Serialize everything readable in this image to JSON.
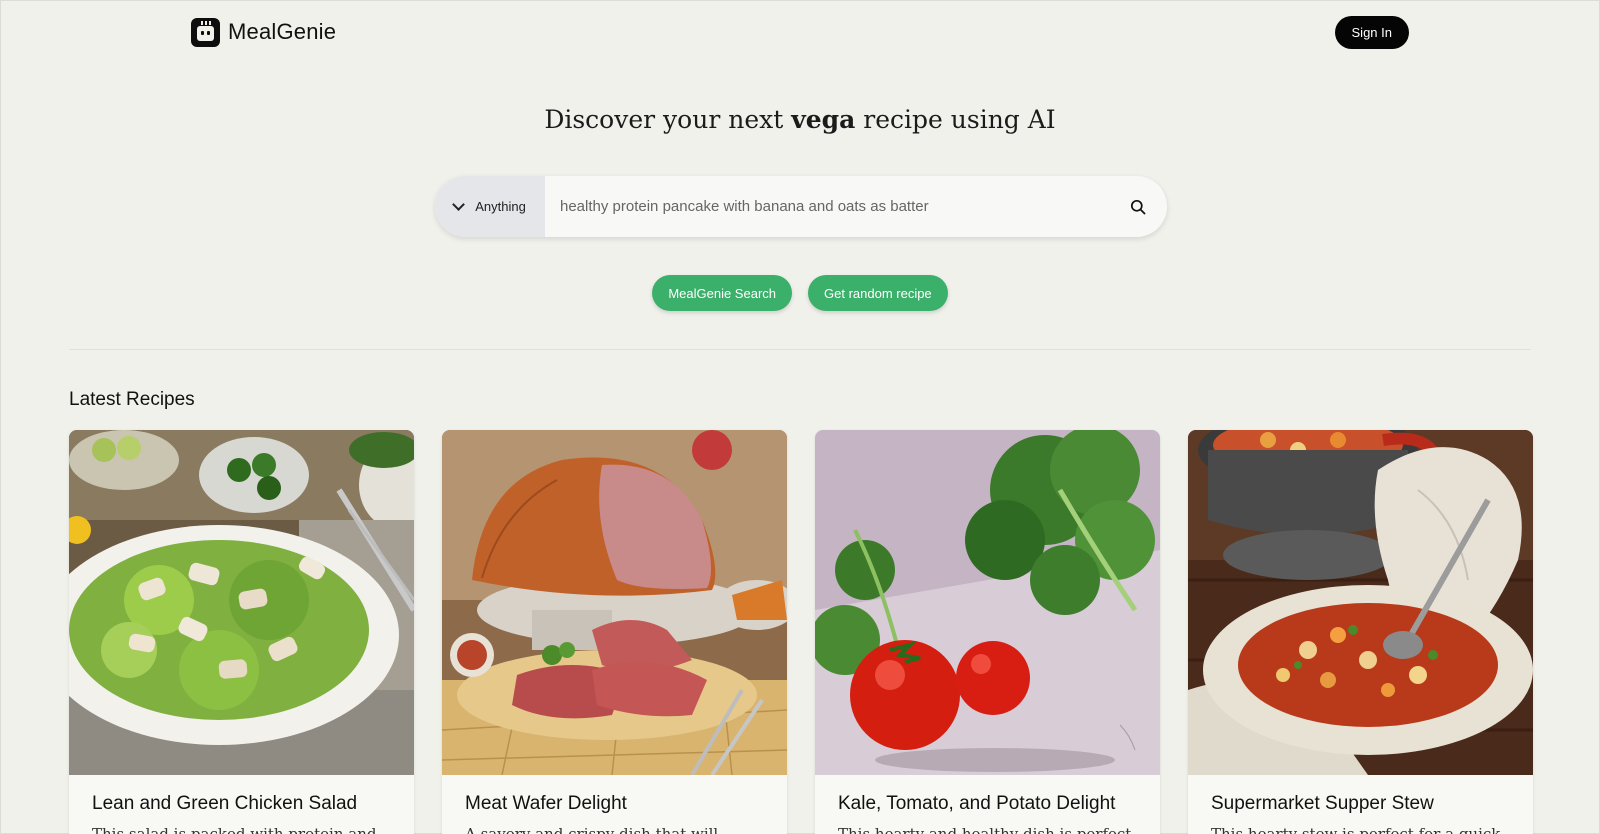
{
  "brand": {
    "name": "MealGenie",
    "logo_icon": "robot-chef-icon"
  },
  "header": {
    "signin_label": "Sign In"
  },
  "hero": {
    "title_prefix": "Discover your next ",
    "title_highlight": "vega",
    "title_suffix": " recipe using AI"
  },
  "search": {
    "category_selected": "Anything",
    "placeholder": "healthy protein pancake with banana and oats as batter",
    "search_icon": "search-icon"
  },
  "actions": {
    "search_label": "MealGenie Search",
    "random_label": "Get random recipe"
  },
  "latest": {
    "heading": "Latest Recipes",
    "recipes": [
      {
        "title": "Lean and Green Chicken Salad",
        "description": "This salad is packed with protein and"
      },
      {
        "title": "Meat Wafer Delight",
        "description": "A savory and crispy dish that will"
      },
      {
        "title": "Kale, Tomato, and Potato Delight",
        "description": "This hearty and healthy dish is perfect"
      },
      {
        "title": "Supermarket Supper Stew",
        "description": "This hearty stew is perfect for a quick"
      }
    ]
  },
  "colors": {
    "accent": "#3bb06a",
    "background": "#f1f1ec",
    "dark": "#050505"
  }
}
